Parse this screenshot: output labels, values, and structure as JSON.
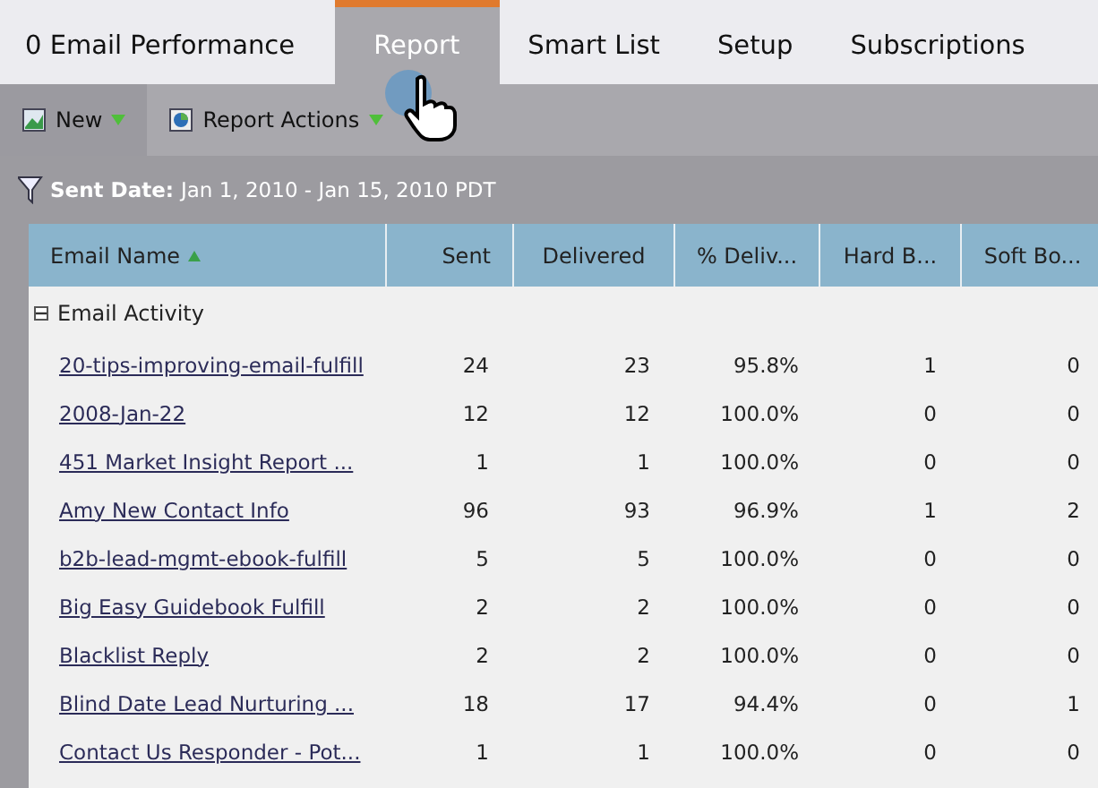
{
  "tabs": [
    {
      "label": "0 Email Performance",
      "selected": false
    },
    {
      "label": "Report",
      "selected": true
    },
    {
      "label": "Smart List",
      "selected": false
    },
    {
      "label": "Setup",
      "selected": false
    },
    {
      "label": "Subscriptions",
      "selected": false
    }
  ],
  "toolbar": [
    {
      "label": "New",
      "selected": true
    },
    {
      "label": "Report Actions",
      "selected": false
    }
  ],
  "filter": {
    "label": "Sent Date:",
    "value": "Jan 1, 2010 - Jan 15, 2010 PDT"
  },
  "table": {
    "columns": [
      "Email Name",
      "Sent",
      "Delivered",
      "% Deliv...",
      "Hard B...",
      "Soft Bo..."
    ],
    "group": {
      "label": "Email Activity",
      "expanded": true
    },
    "rows": [
      [
        "20-tips-improving-email-fulfill",
        "24",
        "23",
        "95.8%",
        "1",
        "0"
      ],
      [
        "2008-Jan-22",
        "12",
        "12",
        "100.0%",
        "0",
        "0"
      ],
      [
        "451 Market Insight Report ...",
        "1",
        "1",
        "100.0%",
        "0",
        "0"
      ],
      [
        "Amy New Contact Info",
        "96",
        "93",
        "96.9%",
        "1",
        "2"
      ],
      [
        "b2b-lead-mgmt-ebook-fulfill",
        "5",
        "5",
        "100.0%",
        "0",
        "0"
      ],
      [
        "Big Easy Guidebook Fulfill",
        "2",
        "2",
        "100.0%",
        "0",
        "0"
      ],
      [
        "Blacklist Reply",
        "2",
        "2",
        "100.0%",
        "0",
        "0"
      ],
      [
        "Blind Date Lead Nurturing ...",
        "18",
        "17",
        "94.4%",
        "0",
        "1"
      ],
      [
        "Contact Us Responder - Pot...",
        "1",
        "1",
        "100.0%",
        "0",
        "0"
      ]
    ]
  }
}
